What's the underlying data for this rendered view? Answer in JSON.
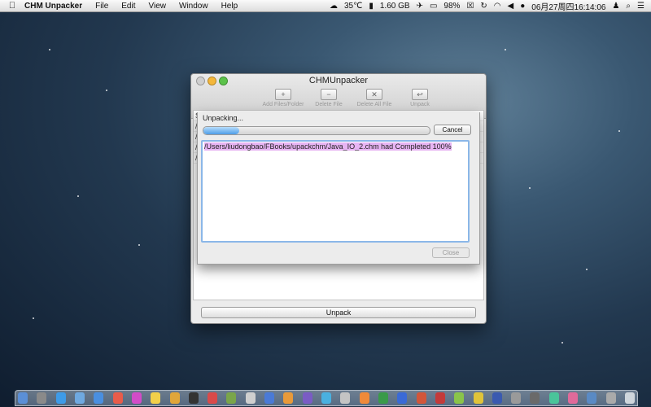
{
  "menubar": {
    "app_name": "CHM Unpacker",
    "menus": [
      "File",
      "Edit",
      "View",
      "Window",
      "Help"
    ],
    "weather": "35℃",
    "memory": "1.60 GB",
    "battery_pct": "98%",
    "clock": "06月27周四16:14:06"
  },
  "window": {
    "title": "CHMUnpacker",
    "toolbar": {
      "add_label": "Add Files/Folder",
      "delete_label": "Delete File",
      "delete_all_label": "Delete All File",
      "unpack_label": "Unpack"
    },
    "list_rows": [
      "S",
      "/",
      "/",
      "/",
      "/"
    ],
    "unpack_button": "Unpack"
  },
  "sheet": {
    "status": "Unpacking...",
    "progress_fraction": 0.16,
    "cancel_button": "Cancel",
    "log_line": "/Users/liudongbao/FBooks/upackchm/Java_IO_2.chm had Completed 100%",
    "close_button": "Close"
  },
  "colors": {
    "progress": "#4d9de8",
    "log_highlight": "#e7b4f3",
    "focus_ring": "#8bb7e8"
  },
  "dock": {
    "icons": [
      "finder",
      "system-prefs",
      "safari",
      "mail",
      "app-store",
      "calendar",
      "itunes",
      "notes",
      "chrome",
      "terminal",
      "pdf",
      "chm",
      "text",
      "xcode",
      "ibooks",
      "epub",
      "chrome-2",
      "app",
      "sublime",
      "excel",
      "word",
      "powerpoint",
      "acrobat",
      "app",
      "app",
      "photoshop",
      "app",
      "app",
      "app",
      "app",
      "app",
      "app",
      "trash"
    ]
  }
}
